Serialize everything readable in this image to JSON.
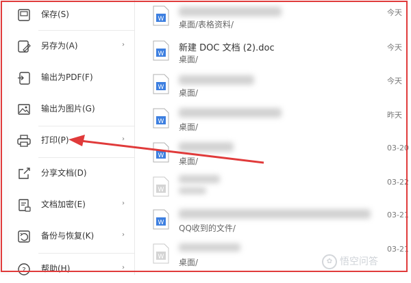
{
  "menu": {
    "items": [
      {
        "label": "保存(S)",
        "icon": "save-icon",
        "arrow": ""
      },
      {
        "label": "另存为(A)",
        "icon": "save-as-icon",
        "arrow": "›"
      },
      {
        "label": "输出为PDF(F)",
        "icon": "export-pdf-icon",
        "arrow": ""
      },
      {
        "label": "输出为图片(G)",
        "icon": "export-image-icon",
        "arrow": ""
      },
      {
        "label": "打印(P)",
        "icon": "print-icon",
        "arrow": "›"
      },
      {
        "label": "分享文档(D)",
        "icon": "share-icon",
        "arrow": ""
      },
      {
        "label": "文档加密(E)",
        "icon": "encrypt-icon",
        "arrow": "›"
      },
      {
        "label": "备份与恢复(K)",
        "icon": "backup-icon",
        "arrow": "›"
      },
      {
        "label": "帮助(H)",
        "icon": "help-icon",
        "arrow": "›"
      }
    ]
  },
  "files": {
    "rows": [
      {
        "name": "",
        "path": "桌面/表格资料/",
        "time": "今天"
      },
      {
        "name": "新建 DOC 文档 (2).doc",
        "path": "桌面/",
        "time": "今天"
      },
      {
        "name": "",
        "path": "桌面/",
        "time": "今天"
      },
      {
        "name": "",
        "path": "桌面/",
        "time": "昨天"
      },
      {
        "name": "",
        "path": "桌面/",
        "time": "03-20"
      },
      {
        "name": "",
        "path": "",
        "time": "03-22"
      },
      {
        "name": "",
        "path": "QQ收到的文件/",
        "time": "03-21"
      },
      {
        "name": "",
        "path": "桌面/",
        "time": "03-21"
      }
    ]
  },
  "watermark": "悟空问答",
  "colors": {
    "frame": "#e03a3a",
    "doc_blue": "#3d7fe0",
    "doc_gray": "#b8b8b8"
  }
}
